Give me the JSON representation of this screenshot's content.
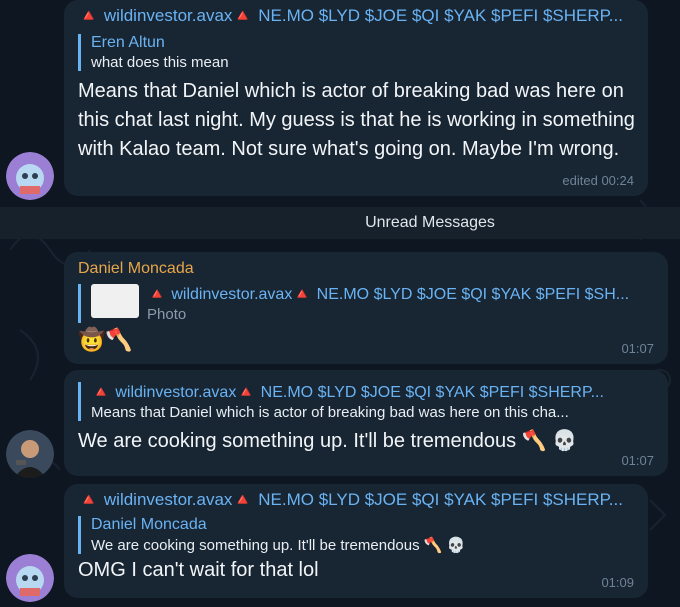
{
  "messages": {
    "m1": {
      "forward_from": "🔺 wildinvestor.avax🔺 NE.MO $LYD $JOE $QI $YAK $PEFI $SHERP...",
      "reply_name": "Eren Altun",
      "reply_text": "what does this mean",
      "text": "Means that Daniel which is actor of breaking bad was here on this chat last night. My guess is that he is working in something with Kalao team. Not sure what's going on. Maybe I'm wrong.",
      "time": "edited 00:24"
    },
    "unread_label": "Unread Messages",
    "m2": {
      "author": "Daniel Moncada",
      "reply_name": "🔺 wildinvestor.avax🔺 NE.MO $LYD $JOE $QI $YAK $PEFI $SH...",
      "reply_text": "Photo",
      "emoji": "🤠🪓",
      "time": "01:07"
    },
    "m3": {
      "reply_name": "🔺 wildinvestor.avax🔺 NE.MO $LYD $JOE $QI $YAK $PEFI $SHERP...",
      "reply_text": "Means that Daniel which is actor of breaking bad was here on this cha...",
      "text": "We are cooking something up. It'll be tremendous 🪓 💀",
      "time": "01:07"
    },
    "m4": {
      "forward_from": "🔺 wildinvestor.avax🔺 NE.MO $LYD $JOE $QI $YAK $PEFI $SHERP...",
      "reply_name": "Daniel Moncada",
      "reply_text": "We are cooking something up. It'll be tremendous 🪓 💀",
      "text": "OMG I can't wait for that lol",
      "time": "01:09"
    }
  },
  "colors": {
    "background": "#0e1621",
    "bubble": "#182533",
    "link": "#6ab3f3",
    "author": "#e8a64a",
    "accent_red": "#e84142"
  }
}
